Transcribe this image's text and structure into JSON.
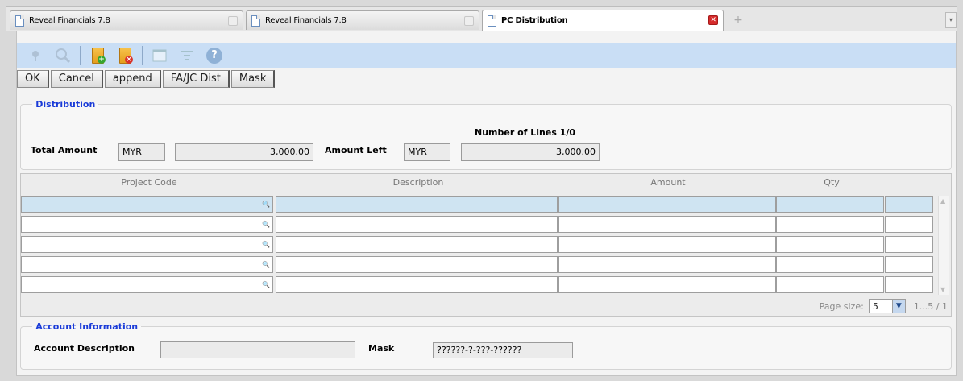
{
  "tabs": [
    {
      "label": "Reveal Financials 7.8",
      "active": false
    },
    {
      "label": "Reveal Financials 7.8",
      "active": false
    },
    {
      "label": "PC Distribution",
      "active": true
    }
  ],
  "toolbar": {
    "icons": [
      "pin-icon",
      "search-icon",
      "new-folder-icon",
      "delete-folder-icon",
      "window-icon",
      "filter-icon",
      "help-icon"
    ],
    "help_glyph": "?"
  },
  "buttons": {
    "ok": "OK",
    "cancel": "Cancel",
    "append": "append",
    "fajc": "FA/JC Dist",
    "mask": "Mask"
  },
  "distribution": {
    "legend": "Distribution",
    "number_of_lines": "Number of Lines 1/0",
    "total_amount_label": "Total Amount",
    "total_currency": "MYR",
    "total_value": "3,000.00",
    "amount_left_label": "Amount Left",
    "left_currency": "MYR",
    "left_value": "3,000.00"
  },
  "grid": {
    "columns": [
      "Project Code",
      "Description",
      "Amount",
      "Qty"
    ],
    "rows": [
      {
        "project_code": "",
        "description": "",
        "amount": "",
        "qty": "",
        "extra": "",
        "selected": true
      },
      {
        "project_code": "",
        "description": "",
        "amount": "",
        "qty": "",
        "extra": "",
        "selected": false
      },
      {
        "project_code": "",
        "description": "",
        "amount": "",
        "qty": "",
        "extra": "",
        "selected": false
      },
      {
        "project_code": "",
        "description": "",
        "amount": "",
        "qty": "",
        "extra": "",
        "selected": false
      },
      {
        "project_code": "",
        "description": "",
        "amount": "",
        "qty": "",
        "extra": "",
        "selected": false
      }
    ],
    "pager": {
      "page_size_label": "Page size:",
      "page_size": "5",
      "range": "1...5 / 1"
    }
  },
  "account": {
    "legend": "Account Information",
    "description_label": "Account Description",
    "description_value": "",
    "mask_label": "Mask",
    "mask_value": "??????-?-???-??????"
  }
}
